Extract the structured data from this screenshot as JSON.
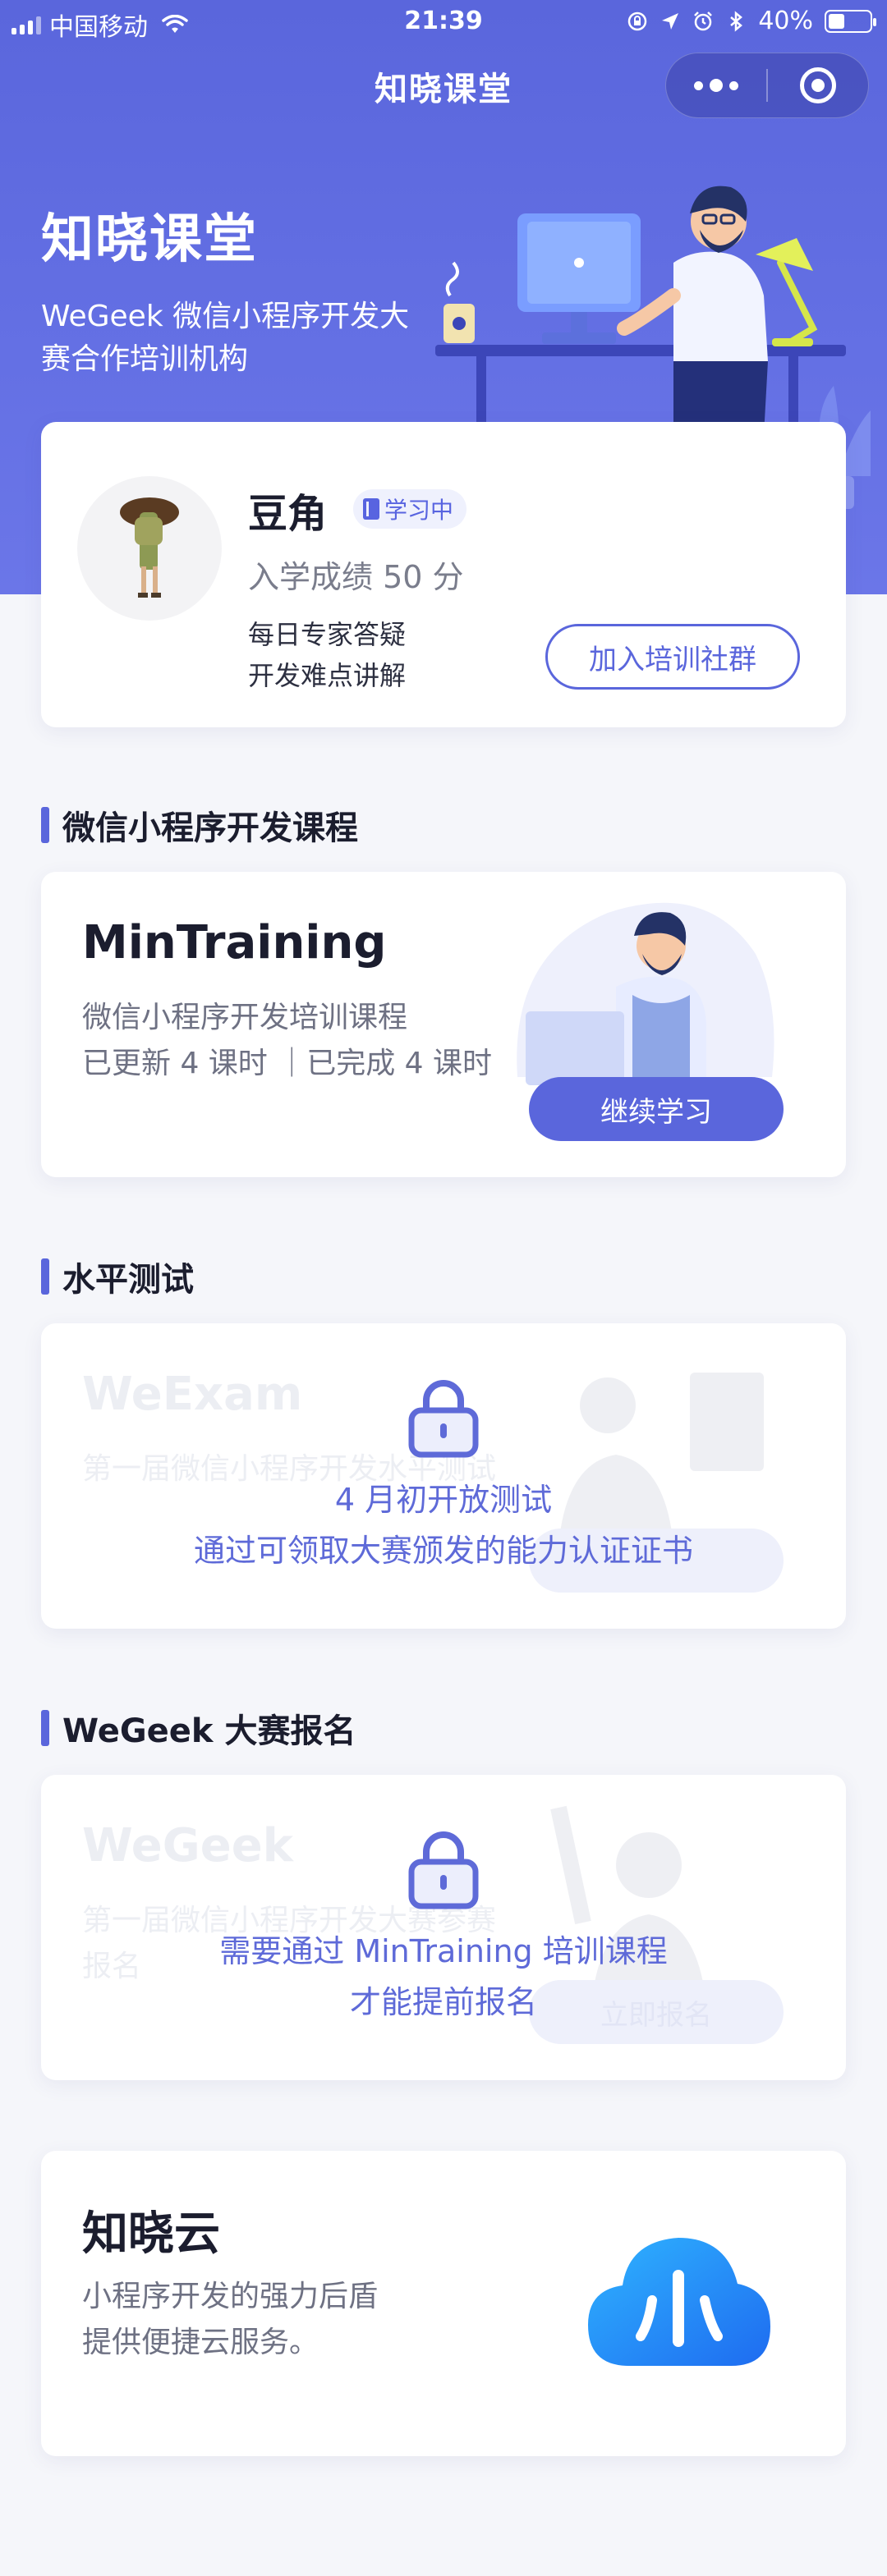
{
  "status_bar": {
    "carrier": "中国移动",
    "time": "21:39",
    "battery": "40%",
    "battery_level": 0.4
  },
  "nav": {
    "title": "知晓课堂"
  },
  "hero": {
    "title": "知晓课堂",
    "subtitle": "WeGeek 微信小程序开发大赛合作培训机构"
  },
  "profile": {
    "name": "豆角",
    "badge": "学习中",
    "score": "入学成绩 50 分",
    "features": [
      "每日专家答疑",
      "开发难点讲解"
    ],
    "join_button": "加入培训社群"
  },
  "sections": {
    "course_heading": "微信小程序开发课程",
    "exam_heading": "水平测试",
    "contest_heading": "WeGeek 大赛报名"
  },
  "course": {
    "title": "MinTraining",
    "desc": "微信小程序开发培训课程",
    "progress": "已更新 4 课时 ｜已完成 4 课时",
    "button": "继续学习"
  },
  "exam": {
    "title": "WeExam",
    "desc": "第一届微信小程序开发水平测试",
    "lock_line1": "4 月初开放测试",
    "lock_line2": "通过可领取大赛颁发的能力认证证书"
  },
  "contest": {
    "title": "WeGeek",
    "desc": "第一届微信小程序开发大赛参赛报名",
    "button": "立即报名",
    "lock_line1": "需要通过 MinTraining 培训课程",
    "lock_line2": "才能提前报名"
  },
  "cloud": {
    "title": "知晓云",
    "desc_line1": "小程序开发的强力后盾",
    "desc_line2": "提供便捷云服务。"
  },
  "colors": {
    "primary": "#5a66dc",
    "hero_bg": "#6470e4",
    "page_bg": "#f5f6fa"
  }
}
